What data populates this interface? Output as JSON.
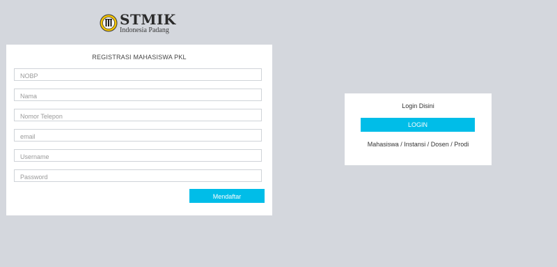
{
  "logo": {
    "title": "STMIK",
    "subtitle": "Indonesia Padang"
  },
  "registration": {
    "title": "REGISTRASI MAHASISWA PKL",
    "fields": [
      {
        "placeholder": "NOBP",
        "value": ""
      },
      {
        "placeholder": "Nama",
        "value": ""
      },
      {
        "placeholder": "Nomor Telepon",
        "value": ""
      },
      {
        "placeholder": "email",
        "value": ""
      },
      {
        "placeholder": "Username",
        "value": ""
      },
      {
        "placeholder": "Password",
        "value": ""
      }
    ],
    "submit_label": "Mendaftar"
  },
  "login": {
    "title": "Login Disini",
    "button_label": "LOGIN",
    "roles_text": "Mahasiswa / Instansi / Dosen / Prodi"
  },
  "colors": {
    "background": "#d4d7dd",
    "accent": "#00bde8",
    "panel": "#ffffff"
  }
}
